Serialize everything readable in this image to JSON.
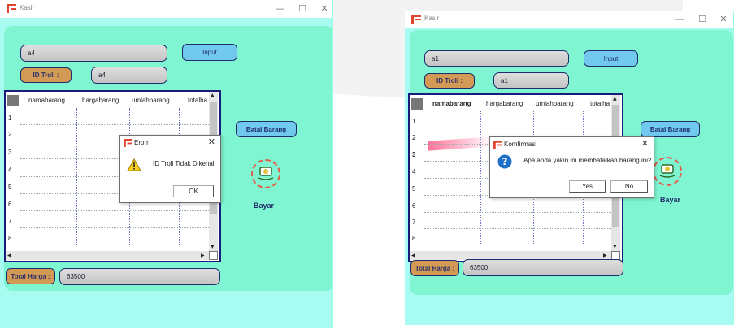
{
  "window1": {
    "title": "Kasir",
    "search_value": "a4",
    "input_button": "Input",
    "id_troli_label": "ID Troli :",
    "id_troli_value": "a4",
    "table": {
      "columns": [
        "namabarang",
        "hargabarang",
        "umlahbarang",
        "totalha"
      ],
      "rows": [
        "1",
        "2",
        "3",
        "4",
        "5",
        "6",
        "7",
        "8"
      ]
    },
    "batal_button": "Batal Barang",
    "bayar_label": "Bayar",
    "total_label": "Total Harga :",
    "total_value": "63500",
    "dialog": {
      "title": "Erorr",
      "icon": "warning-icon",
      "message": "ID Troli Tidak Dikenal",
      "ok_button": "OK"
    }
  },
  "window2": {
    "title": "Kasir",
    "search_value": "a1",
    "input_button": "Input",
    "id_troli_label": "ID Troli :",
    "id_troli_value": "a1",
    "table": {
      "columns": [
        "namabarang",
        "hargabarang",
        "umlahbarang",
        "totalha"
      ],
      "rows": [
        "1",
        "2",
        "3",
        "4",
        "5",
        "6",
        "7",
        "8"
      ]
    },
    "batal_button": "Batal Barang",
    "bayar_label": "Bayar",
    "total_label": "Total Harga :",
    "total_value": "63500",
    "dialog": {
      "title": "Komfirmasi",
      "icon": "question-icon",
      "message": "Apa anda yakin ini membatalkan barang ini?",
      "yes_button": "Yes",
      "no_button": "No"
    }
  },
  "colors": {
    "window_bg": "#a8fbf1",
    "panel_bg": "#7ff5d2",
    "label_orange": "#d29a55",
    "button_blue": "#71c9ee",
    "border_navy": "#1e2c6a"
  }
}
